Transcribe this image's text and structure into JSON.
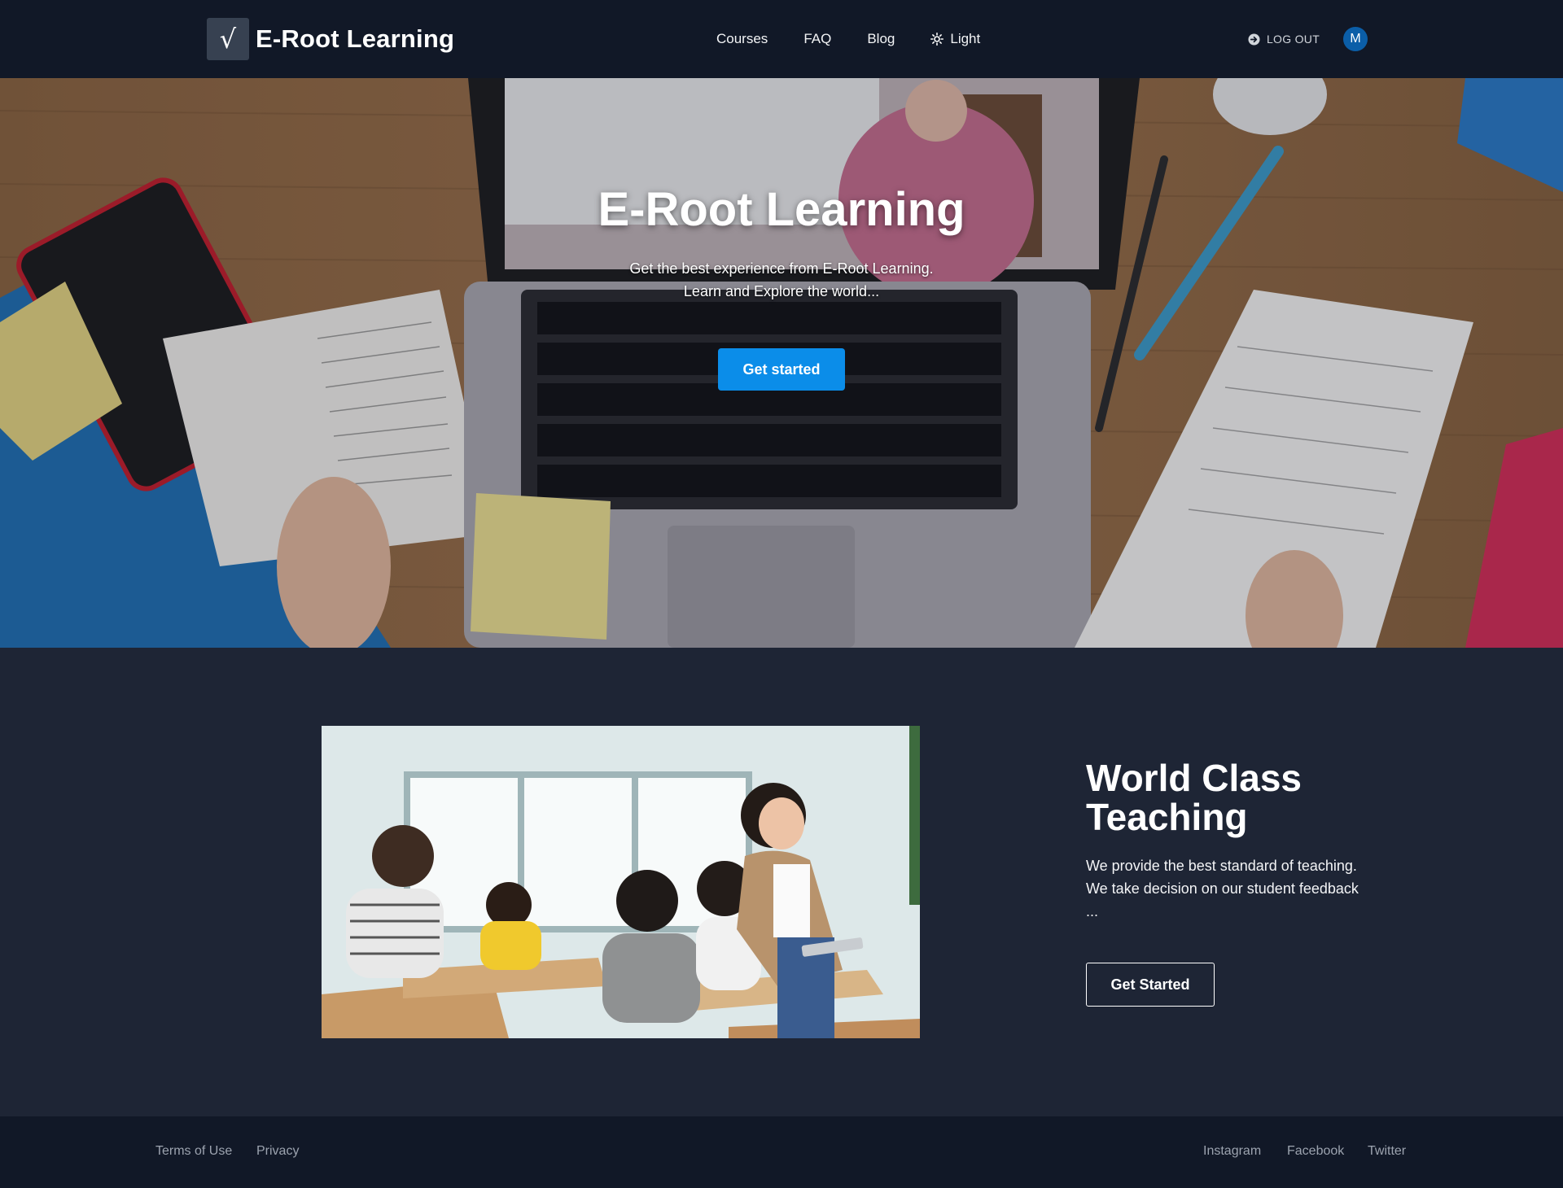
{
  "brand": {
    "logo_symbol": "√",
    "name": "E-Root Learning"
  },
  "nav": {
    "items": [
      "Courses",
      "FAQ",
      "Blog"
    ],
    "theme_label": "Light",
    "logout_label": "LOG OUT",
    "avatar_initial": "M"
  },
  "hero": {
    "title": "E-Root Learning",
    "subtitle_line1": "Get the best experience from E-Root Learning.",
    "subtitle_line2": "Learn and Explore the world...",
    "button_label": "Get started"
  },
  "feature": {
    "title_line1": "World Class",
    "title_line2": "Teaching",
    "text_line1": "We provide the best standard of teaching.",
    "text_line2": "We take decision on our student feedback",
    "text_line3": "...",
    "button_label": "Get Started"
  },
  "footer": {
    "left_links": [
      "Terms of Use",
      "Privacy"
    ],
    "right_links": [
      "Instagram",
      "Facebook",
      "Twitter"
    ]
  },
  "colors": {
    "header_bg": "#111827",
    "page_bg": "#1e2535",
    "primary_button": "#0b8de9",
    "avatar_bg": "#0b5ea8"
  },
  "icons": {
    "logo": "square-root-icon",
    "theme": "sun-icon",
    "logout": "logout-arrow-icon"
  }
}
